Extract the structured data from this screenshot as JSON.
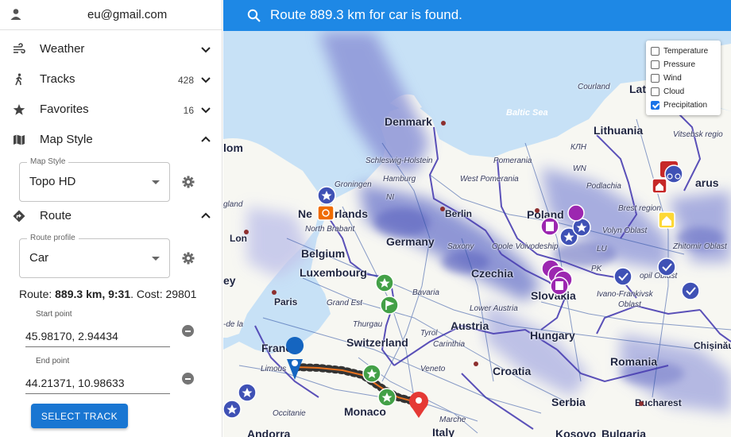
{
  "account": {
    "email": "eu@gmail.com"
  },
  "menu": {
    "weather": {
      "label": "Weather"
    },
    "tracks": {
      "label": "Tracks",
      "count": "428"
    },
    "favorites": {
      "label": "Favorites",
      "count": "16"
    },
    "map_style": {
      "label": "Map Style",
      "field_legend": "Map Style",
      "value": "Topo HD"
    },
    "route": {
      "label": "Route",
      "profile_legend": "Route profile",
      "profile_value": "Car",
      "summary_prefix": "Route: ",
      "summary_strong": "889.3 km",
      "summary_sep": ", ",
      "summary_time": "9:31",
      "summary_cost": ". Cost: 29801",
      "start_label": "Start point",
      "start_value": "45.98170, 2.94434",
      "end_label": "End point",
      "end_value": "44.21371, 10.98633",
      "select_track": "SELECT TRACK"
    }
  },
  "map": {
    "status": "Route 889.3 km for car is found.",
    "layers": [
      {
        "label": "Temperature",
        "checked": false
      },
      {
        "label": "Pressure",
        "checked": false
      },
      {
        "label": "Wind",
        "checked": false
      },
      {
        "label": "Cloud",
        "checked": false
      },
      {
        "label": "Precipitation",
        "checked": true
      }
    ],
    "labels": {
      "denmark": "Denmark",
      "baltic": "Baltic Sea",
      "lithuania": "Lithuania",
      "latvia": "Latvi",
      "courland": "Courland",
      "vitsebsk": "Vitsebsk regio",
      "schleswig": "Schleswig-Holstein",
      "hamburg": "Hamburg",
      "westpom": "West Pomerania",
      "pomerania": "Pomerania",
      "kjn": "КЛН",
      "wn": "WN",
      "podlachia": "Podlachia",
      "arus": "arus",
      "groningen": "Groningen",
      "ni": "NI",
      "netherlands": "Ne",
      "netherlands2": "rlands",
      "brabant": "North Brabant",
      "berlin": "Berlin",
      "poland": "Poland",
      "brest": "Brest region",
      "england": "gland",
      "lom": "lom",
      "lon": "Lon",
      "germany": "Germany",
      "saxony": "Saxony",
      "opole": "Opole Voivodeship",
      "lu": "LU",
      "volyn": "Volyn Oblast",
      "zhitomir": "Zhitomir Oblast",
      "belgium": "Belgium",
      "luxembourg": "Luxembourg",
      "czechia": "Czechia",
      "pk": "PK",
      "ey": "ey",
      "paris": "Paris",
      "grandest": "Grand Est",
      "bavaria": "Bavaria",
      "loweraustria": "Lower Austria",
      "slovakia": "Slovakia",
      "ivano": "Ivano-Frankivsk",
      "oblast": "Oblast",
      "ternopil": "opil Oblast",
      "dela": "-de la",
      "thurgau": "Thurgau",
      "tyrol": "Tyrol",
      "austria": "Austria",
      "hungary": "Hungary",
      "chisinau": "Chișinău",
      "france": "France",
      "switzerland": "Switzerland",
      "carinthia": "Carinthia",
      "limous": "Limous",
      "veneto": "Veneto",
      "croatia": "Croatia",
      "romania": "Romania",
      "serbia": "Serbia",
      "bucharest": "Bucharest",
      "monaco": "Monaco",
      "occitanie": "Occitanie",
      "marche": "Marche",
      "italy": "Italy",
      "andorra": "Andorra",
      "kosovo": "Kosovo",
      "bulgaria": "Bulgaria"
    }
  },
  "colors": {
    "primary": "#1976d2",
    "topbar": "#1e88e5",
    "route": "#333333",
    "marker_red": "#e53935",
    "marker_blue": "#1565c0",
    "favorite": "#3f51b5",
    "marker_green": "#43a047"
  }
}
